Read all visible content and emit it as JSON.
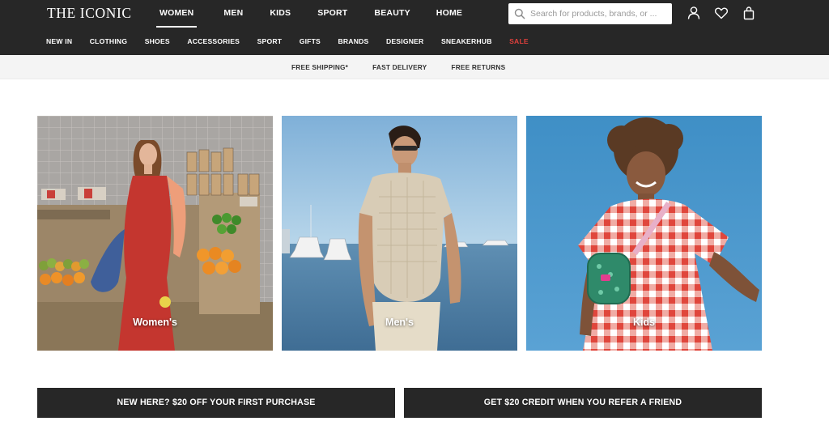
{
  "header": {
    "logo": "THE ICONIC",
    "departments": [
      {
        "label": "WOMEN",
        "active": true
      },
      {
        "label": "MEN"
      },
      {
        "label": "KIDS"
      },
      {
        "label": "SPORT"
      },
      {
        "label": "BEAUTY"
      },
      {
        "label": "HOME"
      }
    ],
    "search": {
      "placeholder": "Search for products, brands, or ...",
      "value": ""
    },
    "icons": [
      "account-icon",
      "wishlist-heart-icon",
      "shopping-bag-icon"
    ],
    "categories": [
      {
        "label": "NEW IN"
      },
      {
        "label": "CLOTHING"
      },
      {
        "label": "SHOES"
      },
      {
        "label": "ACCESSORIES"
      },
      {
        "label": "SPORT"
      },
      {
        "label": "GIFTS"
      },
      {
        "label": "BRANDS"
      },
      {
        "label": "DESIGNER"
      },
      {
        "label": "SNEAKERHUB"
      },
      {
        "label": "SALE",
        "highlight": "#e0403c"
      }
    ]
  },
  "promo": {
    "items": [
      "FREE SHIPPING*",
      "FAST DELIVERY",
      "FREE RETURNS"
    ]
  },
  "tiles": [
    {
      "label": "Women's"
    },
    {
      "label": "Men's"
    },
    {
      "label": "Kids"
    }
  ],
  "cta": {
    "left": "NEW HERE? $20 OFF YOUR FIRST PURCHASE",
    "right": "GET $20 CREDIT WHEN YOU REFER A FRIEND"
  },
  "colors": {
    "header_bg": "#272727",
    "sale": "#e0403c",
    "promo_bg": "#f4f4f4",
    "cta_bg": "#272727"
  }
}
